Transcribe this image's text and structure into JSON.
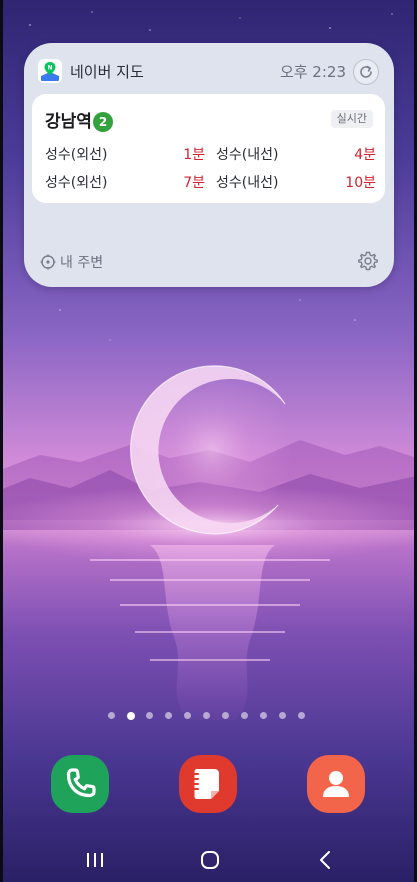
{
  "widget": {
    "app_name": "네이버 지도",
    "updated_time": "오후 2:23",
    "refresh_icon": "refresh-icon",
    "station": {
      "name": "강남역",
      "line_number": "2",
      "line_color": "#33a23d",
      "realtime_label": "실시간",
      "arrivals": [
        {
          "direction": "성수(외선)",
          "minutes": "1분"
        },
        {
          "direction": "성수(내선)",
          "minutes": "4분"
        },
        {
          "direction": "성수(외선)",
          "minutes": "7분"
        },
        {
          "direction": "성수(내선)",
          "minutes": "10분"
        }
      ]
    },
    "nearby_label": "내 주변",
    "nearby_icon": "location-target-icon",
    "settings_icon": "gear-icon"
  },
  "home": {
    "page_count": 11,
    "active_page": 2
  },
  "dock": [
    {
      "name": "phone",
      "icon": "phone-icon",
      "color": "#1fa35a"
    },
    {
      "name": "samsung-notes",
      "icon": "notes-icon",
      "color": "#e03a2e"
    },
    {
      "name": "contacts",
      "icon": "contact-icon",
      "color": "#f2654a"
    }
  ],
  "navbar": {
    "recent_icon": "recent-apps-icon",
    "home_icon": "home-icon",
    "back_icon": "back-icon"
  },
  "colors": {
    "widget_bg": "#dfe3ee",
    "arrival_minutes": "#d0242f",
    "wallpaper_top": "#5d47a8",
    "wallpaper_horizon": "#e79ad8"
  }
}
